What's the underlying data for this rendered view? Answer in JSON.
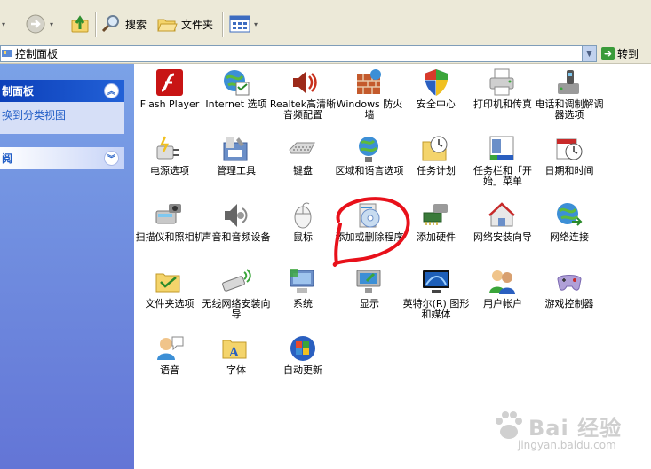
{
  "toolbar": {
    "search_label": "搜索",
    "folders_label": "文件夹"
  },
  "address": {
    "path": "控制面板",
    "goto_label": "转到"
  },
  "left_pane": {
    "panel_title": "制面板",
    "switch_link": "换到分类视图",
    "see_also_title": "阅"
  },
  "items": [
    {
      "label": "Flash Player",
      "icon": "flash-icon"
    },
    {
      "label": "Internet 选项",
      "icon": "internet-options-icon"
    },
    {
      "label": "Realtek高清晰音频配置",
      "icon": "realtek-audio-icon"
    },
    {
      "label": "Windows 防火墙",
      "icon": "firewall-icon"
    },
    {
      "label": "安全中心",
      "icon": "security-center-icon"
    },
    {
      "label": "打印机和传真",
      "icon": "printer-fax-icon"
    },
    {
      "label": "电话和调制解调器选项",
      "icon": "phone-modem-icon"
    },
    {
      "label": "电源选项",
      "icon": "power-options-icon"
    },
    {
      "label": "管理工具",
      "icon": "admin-tools-icon"
    },
    {
      "label": "键盘",
      "icon": "keyboard-icon"
    },
    {
      "label": "区域和语言选项",
      "icon": "region-language-icon"
    },
    {
      "label": "任务计划",
      "icon": "scheduled-tasks-icon"
    },
    {
      "label": "任务栏和「开始」菜单",
      "icon": "taskbar-start-icon"
    },
    {
      "label": "日期和时间",
      "icon": "date-time-icon"
    },
    {
      "label": "扫描仪和照相机",
      "icon": "scanner-camera-icon"
    },
    {
      "label": "声音和音频设备",
      "icon": "sound-devices-icon"
    },
    {
      "label": "鼠标",
      "icon": "mouse-icon"
    },
    {
      "label": "添加或删除程序",
      "icon": "add-remove-programs-icon"
    },
    {
      "label": "添加硬件",
      "icon": "add-hardware-icon"
    },
    {
      "label": "网络安装向导",
      "icon": "network-setup-icon"
    },
    {
      "label": "网络连接",
      "icon": "network-connections-icon"
    },
    {
      "label": "文件夹选项",
      "icon": "folder-options-icon"
    },
    {
      "label": "无线网络安装向导",
      "icon": "wireless-setup-icon"
    },
    {
      "label": "系统",
      "icon": "system-icon"
    },
    {
      "label": "显示",
      "icon": "display-icon"
    },
    {
      "label": "英特尔(R) 图形和媒体",
      "icon": "intel-graphics-icon"
    },
    {
      "label": "用户帐户",
      "icon": "user-accounts-icon"
    },
    {
      "label": "游戏控制器",
      "icon": "game-controllers-icon"
    },
    {
      "label": "语音",
      "icon": "speech-icon"
    },
    {
      "label": "字体",
      "icon": "fonts-icon"
    },
    {
      "label": "自动更新",
      "icon": "auto-update-icon"
    }
  ],
  "watermark": {
    "main": "Bai 经验",
    "sub": "jingyan.baidu.com"
  }
}
